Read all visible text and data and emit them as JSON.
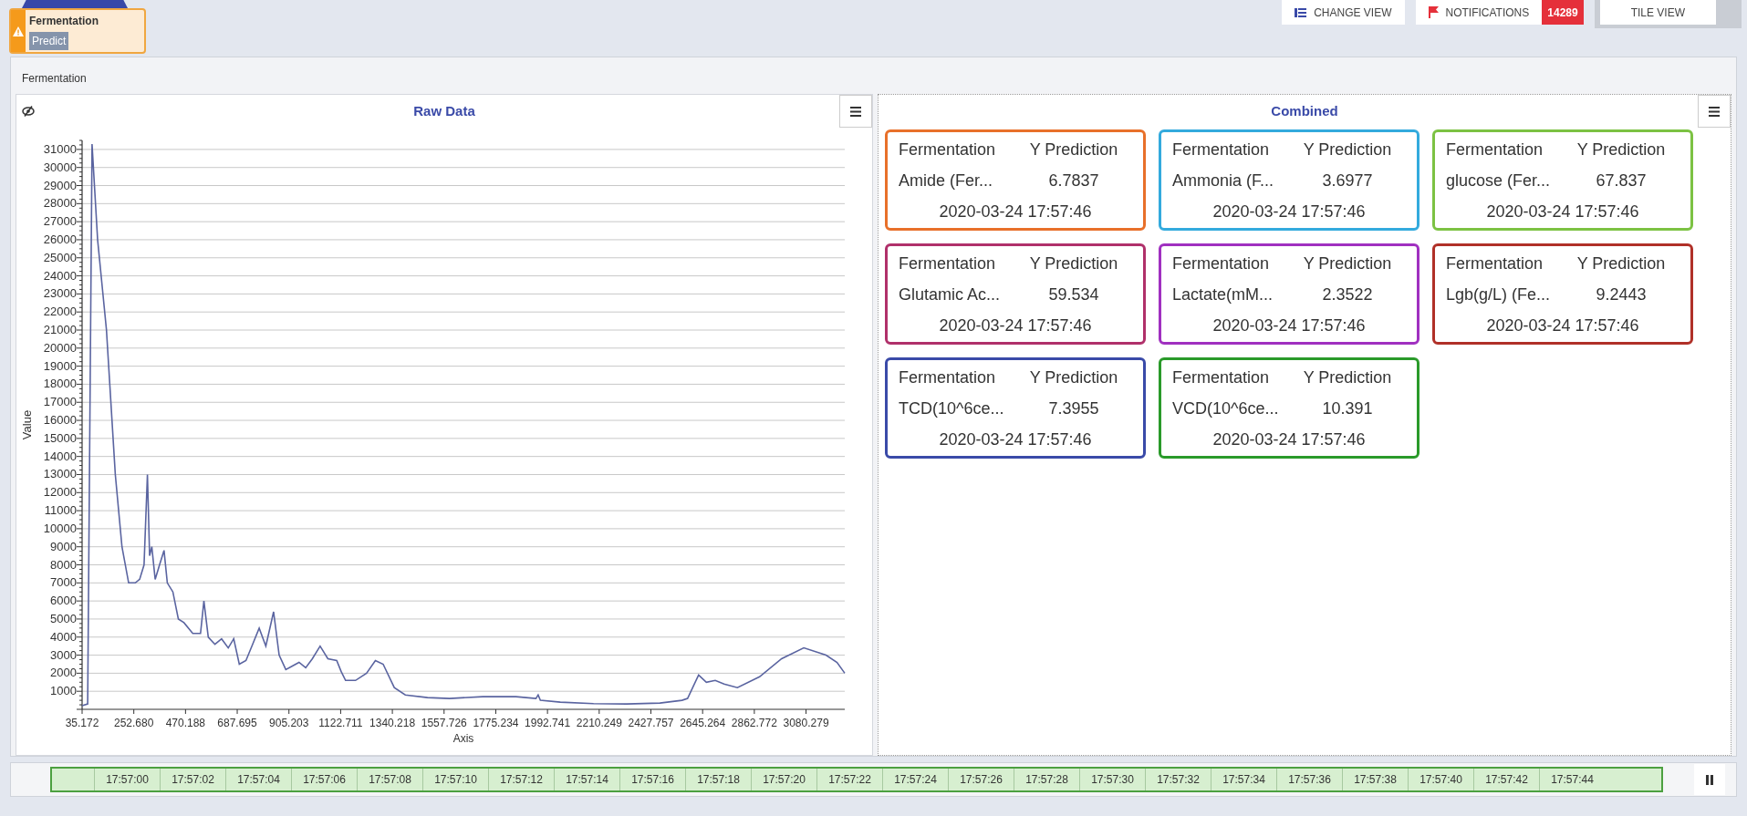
{
  "top_tab": {
    "title": "Fermentation",
    "badge": "Predict"
  },
  "toolbar": [
    {
      "kind": "list",
      "label": "CHANGE VIEW"
    },
    {
      "kind": "flag",
      "label": "NOTIFICATIONS",
      "count": "14289"
    },
    {
      "kind": "plain",
      "label": "TILE VIEW"
    }
  ],
  "panel": {
    "title": "Fermentation",
    "raw_data": {
      "title": "Raw Data",
      "chart_data": {
        "type": "line",
        "grid": true,
        "xlabel": "Axis",
        "ylabel": "Value",
        "xlim": [
          35.172,
          3243.2
        ],
        "ylim": [
          0,
          31500
        ],
        "xticks": [
          {
            "value": 35.172,
            "label": "35.172"
          },
          {
            "value": 252.68,
            "label": "252.680"
          },
          {
            "value": 470.188,
            "label": "470.188"
          },
          {
            "value": 687.695,
            "label": "687.695"
          },
          {
            "value": 905.203,
            "label": "905.203"
          },
          {
            "value": 1122.711,
            "label": "1122.711"
          },
          {
            "value": 1340.218,
            "label": "1340.218"
          },
          {
            "value": 1557.726,
            "label": "1557.726"
          },
          {
            "value": 1775.234,
            "label": "1775.234"
          },
          {
            "value": 1992.741,
            "label": "1992.741"
          },
          {
            "value": 2210.249,
            "label": "2210.249"
          },
          {
            "value": 2427.757,
            "label": "2427.757"
          },
          {
            "value": 2645.264,
            "label": "2645.264"
          },
          {
            "value": 2862.772,
            "label": "2862.772"
          },
          {
            "value": 3080.279,
            "label": "3080.279"
          }
        ],
        "yticks": [
          1000,
          2000,
          3000,
          4000,
          5000,
          6000,
          7000,
          8000,
          9000,
          10000,
          11000,
          12000,
          13000,
          14000,
          15000,
          16000,
          17000,
          18000,
          19000,
          20000,
          21000,
          22000,
          23000,
          24000,
          25000,
          26000,
          27000,
          28000,
          29000,
          30000,
          31000
        ],
        "x": [
          35.2,
          58.5,
          77.1,
          100.4,
          137.6,
          174.9,
          202.8,
          230.7,
          258.7,
          277.3,
          295.9,
          309.9,
          319.2,
          328.5,
          342.5,
          361.1,
          379.7,
          393.7,
          417.0,
          440.2,
          463.5,
          500.8,
          533.4,
          547.3,
          566.0,
          593.9,
          621.8,
          649.8,
          673.1,
          696.4,
          724.3,
          752.2,
          780.1,
          808.1,
          840.7,
          863.9,
          891.9,
          919.8,
          947.8,
          975.7,
          1003.6,
          1036.2,
          1068.8,
          1106.1,
          1124.7,
          1143.3,
          1185.2,
          1231.8,
          1269.0,
          1301.6,
          1348.2,
          1394.7,
          1487.9,
          1581.0,
          1720.7,
          1860.3,
          1944.1,
          1953.5,
          1962.8,
          2046.6,
          2186.3,
          2325.9,
          2465.6,
          2558.7,
          2582.0,
          2628.6,
          2661.2,
          2698.4,
          2735.7,
          2791.6,
          2884.7,
          2977.8,
          3070.9,
          3164.0,
          3210.6,
          3243.2
        ],
        "series": [
          {
            "color": "#5a64a0",
            "values": [
              200,
              300,
              31300,
              26000,
              21000,
              13000,
              9000,
              7000,
              7000,
              7200,
              8000,
              13000,
              8500,
              9000,
              7200,
              8000,
              8800,
              7000,
              6500,
              5000,
              4800,
              4200,
              4200,
              6000,
              4000,
              3600,
              3900,
              3400,
              3900,
              2500,
              2700,
              3600,
              4500,
              3500,
              5400,
              3000,
              2200,
              2400,
              2600,
              2300,
              2800,
              3500,
              2800,
              2700,
              2100,
              1600,
              1600,
              2000,
              2700,
              2500,
              1200,
              800,
              650,
              600,
              700,
              700,
              600,
              800,
              500,
              400,
              320,
              300,
              350,
              500,
              600,
              1900,
              1500,
              1600,
              1400,
              1200,
              1800,
              2800,
              3400,
              3000,
              2600,
              2000
            ]
          }
        ]
      }
    },
    "combined": {
      "title": "Combined",
      "cards": [
        {
          "header_left": "Fermentation",
          "header_right": "Y Prediction",
          "name": "Amide (Fer...",
          "value": "6.7837",
          "timestamp": "2020-03-24 17:57:46",
          "color": "#e8702a"
        },
        {
          "header_left": "Fermentation",
          "header_right": "Y Prediction",
          "name": "Ammonia (F...",
          "value": "3.6977",
          "timestamp": "2020-03-24 17:57:46",
          "color": "#33aadd"
        },
        {
          "header_left": "Fermentation",
          "header_right": "Y Prediction",
          "name": "glucose (Fer...",
          "value": "67.837",
          "timestamp": "2020-03-24 17:57:46",
          "color": "#7cc243"
        },
        {
          "header_left": "Fermentation",
          "header_right": "Y Prediction",
          "name": "Glutamic Ac...",
          "value": "59.534",
          "timestamp": "2020-03-24 17:57:46",
          "color": "#b0306a"
        },
        {
          "header_left": "Fermentation",
          "header_right": "Y Prediction",
          "name": "Lactate(mM...",
          "value": "2.3522",
          "timestamp": "2020-03-24 17:57:46",
          "color": "#a030c0"
        },
        {
          "header_left": "Fermentation",
          "header_right": "Y Prediction",
          "name": "Lgb(g/L) (Fe...",
          "value": "9.2443",
          "timestamp": "2020-03-24 17:57:46",
          "color": "#b03028"
        },
        {
          "header_left": "Fermentation",
          "header_right": "Y Prediction",
          "name": "TCD(10^6ce...",
          "value": "7.3955",
          "timestamp": "2020-03-24 17:57:46",
          "color": "#3a4aa8"
        },
        {
          "header_left": "Fermentation",
          "header_right": "Y Prediction",
          "name": "VCD(10^6ce...",
          "value": "10.391",
          "timestamp": "2020-03-24 17:57:46",
          "color": "#2a9a2a"
        }
      ]
    }
  },
  "timeline": {
    "labels": [
      "17:57:00",
      "17:57:02",
      "17:57:04",
      "17:57:06",
      "17:57:08",
      "17:57:10",
      "17:57:12",
      "17:57:14",
      "17:57:16",
      "17:57:18",
      "17:57:20",
      "17:57:22",
      "17:57:24",
      "17:57:26",
      "17:57:28",
      "17:57:30",
      "17:57:32",
      "17:57:34",
      "17:57:36",
      "17:57:38",
      "17:57:40",
      "17:57:42",
      "17:57:44"
    ]
  }
}
